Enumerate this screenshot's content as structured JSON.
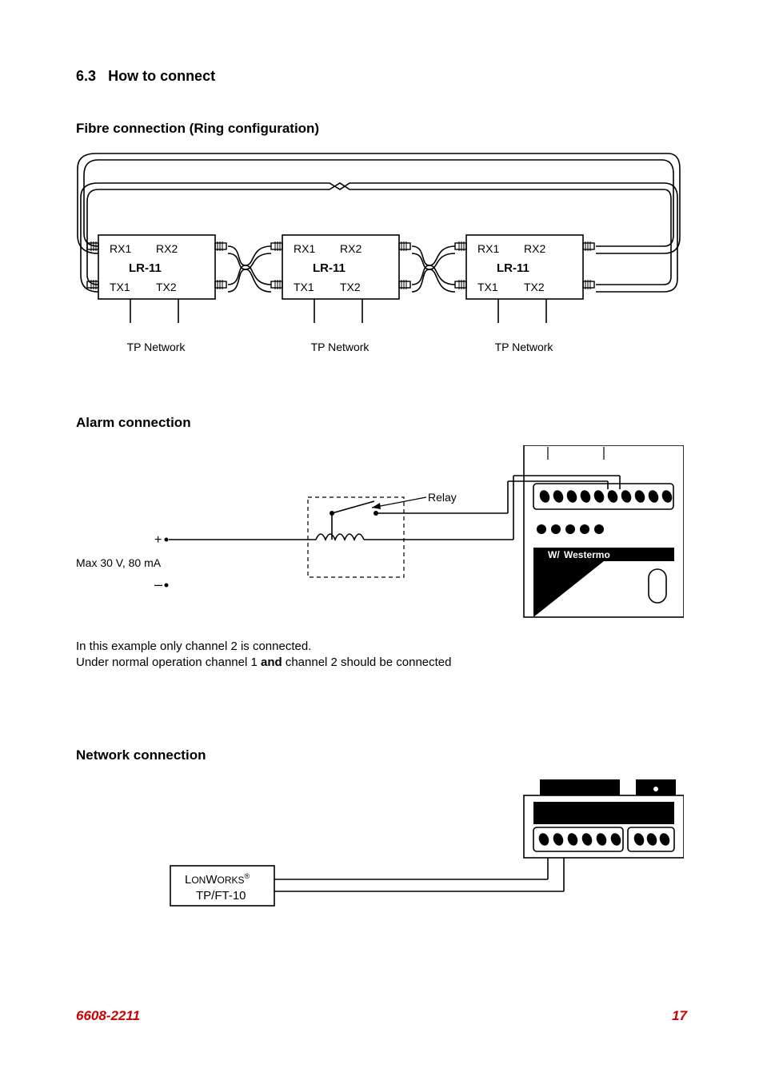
{
  "section": {
    "number": "6.3",
    "title": "How to connect"
  },
  "fibre": {
    "title": "Fibre connection (Ring configuration)",
    "device_label": "LR-11",
    "ports": {
      "rx1": "RX1",
      "rx2": "RX2",
      "tx1": "TX1",
      "tx2": "TX2"
    },
    "tp_network": "TP Network"
  },
  "alarm": {
    "title": "Alarm connection",
    "relay_label": "Relay",
    "plus": "+",
    "minus": "–",
    "max_label": "Max 30 V, 80 mA",
    "brand": "Westermo",
    "note_line1": "In this example only channel 2 is connected.",
    "note_line2_a": "Under normal operation channel 1 ",
    "note_line2_b": "and",
    "note_line2_c": " channel 2 should be connected"
  },
  "network": {
    "title": "Network connection",
    "lonworks_a": "L",
    "lonworks_b": "ON",
    "lonworks_c": "W",
    "lonworks_d": "ORKS",
    "lonworks_sup": "®",
    "tpft": "TP/FT-10"
  },
  "footer": {
    "left": "6608-2211",
    "right": "17"
  }
}
